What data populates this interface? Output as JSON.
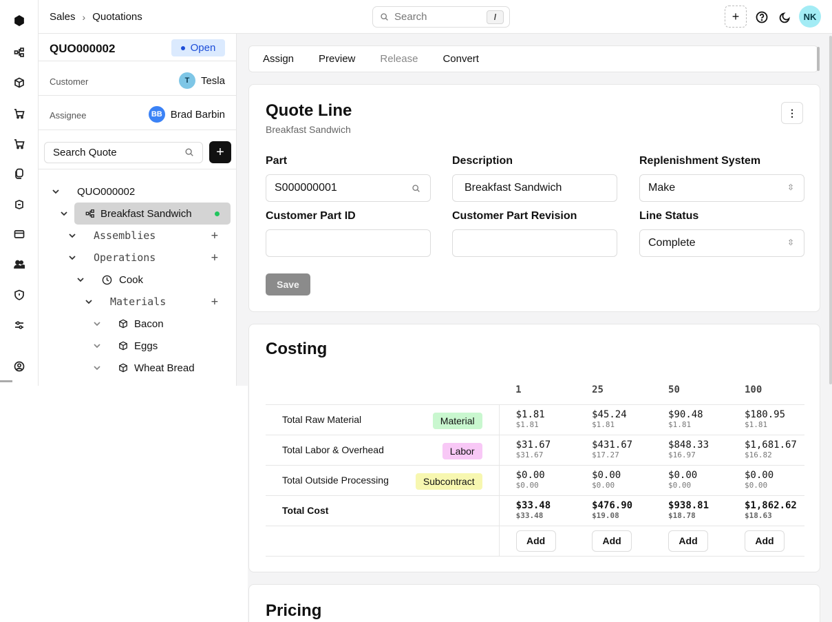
{
  "header": {
    "breadcrumb": [
      "Sales",
      "Quotations"
    ],
    "search_placeholder": "Search",
    "search_shortcut": "/",
    "user_initials": "NK"
  },
  "sidebar": {
    "quote_id": "QUO000002",
    "status": "Open",
    "customer_label": "Customer",
    "customer_initial": "T",
    "customer_name": "Tesla",
    "assignee_label": "Assignee",
    "assignee_initials": "BB",
    "assignee_name": "Brad Barbin",
    "search_placeholder": "Search Quote",
    "tree": {
      "root": "QUO000002",
      "line": "Breakfast Sandwich",
      "assemblies": "Assemblies",
      "operations": "Operations",
      "operation_cook": "Cook",
      "materials": "Materials",
      "material_items": [
        "Bacon",
        "Eggs",
        "Wheat Bread"
      ]
    }
  },
  "actions": {
    "assign": "Assign",
    "preview": "Preview",
    "release": "Release",
    "convert": "Convert"
  },
  "quote_line": {
    "title": "Quote Line",
    "subtitle": "Breakfast Sandwich",
    "part_label": "Part",
    "part_value": "S000000001",
    "description_label": "Description",
    "description_value": "Breakfast Sandwich",
    "replenishment_label": "Replenishment System",
    "replenishment_value": "Make",
    "customer_part_id_label": "Customer Part ID",
    "customer_part_id_value": "",
    "customer_part_revision_label": "Customer Part Revision",
    "customer_part_revision_value": "",
    "line_status_label": "Line Status",
    "line_status_value": "Complete",
    "save_label": "Save"
  },
  "costing": {
    "title": "Costing",
    "quantities": [
      "1",
      "25",
      "50",
      "100"
    ],
    "rows": [
      {
        "label": "Total Raw Material",
        "tag": "Material",
        "tag_color": "#c9f7cf",
        "totals": [
          "$1.81",
          "$45.24",
          "$90.48",
          "$180.95"
        ],
        "unit": [
          "$1.81",
          "$1.81",
          "$1.81",
          "$1.81"
        ]
      },
      {
        "label": "Total Labor & Overhead",
        "tag": "Labor",
        "tag_color": "#f8c8f6",
        "totals": [
          "$31.67",
          "$431.67",
          "$848.33",
          "$1,681.67"
        ],
        "unit": [
          "$31.67",
          "$17.27",
          "$16.97",
          "$16.82"
        ]
      },
      {
        "label": "Total Outside Processing",
        "tag": "Subcontract",
        "tag_color": "#f7f7b0",
        "totals": [
          "$0.00",
          "$0.00",
          "$0.00",
          "$0.00"
        ],
        "unit": [
          "$0.00",
          "$0.00",
          "$0.00",
          "$0.00"
        ]
      },
      {
        "label": "Total Cost",
        "tag": "",
        "totals": [
          "$33.48",
          "$476.90",
          "$938.81",
          "$1,862.62"
        ],
        "unit": [
          "$33.48",
          "$19.08",
          "$18.78",
          "$18.63"
        ]
      }
    ],
    "add_label": "Add"
  },
  "pricing": {
    "title": "Pricing"
  }
}
